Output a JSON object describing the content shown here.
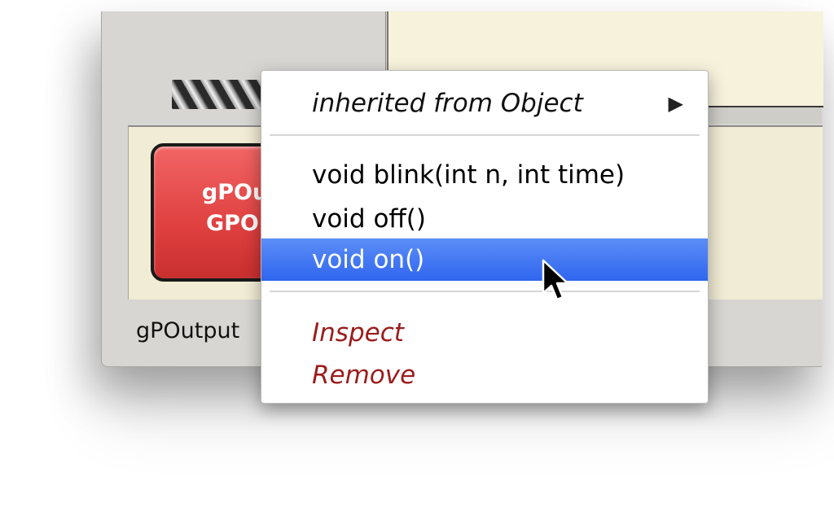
{
  "object_bench": {
    "card_line1": "gPOut",
    "card_line2": "GPOu",
    "object_name": "gPOutput"
  },
  "context_menu": {
    "submenu": {
      "label": "inherited from Object",
      "arrow_icon": "triangle-right-icon"
    },
    "methods": [
      "void blink(int n, int time)",
      "void off()",
      "void on()"
    ],
    "highlighted_method": "void on()",
    "actions": [
      "Inspect",
      "Remove"
    ]
  },
  "colors": {
    "highlight": "#2f66ef",
    "action_text": "#9b1c1c",
    "object_card": "#e04040",
    "editor_background": "#f7f2dc"
  }
}
